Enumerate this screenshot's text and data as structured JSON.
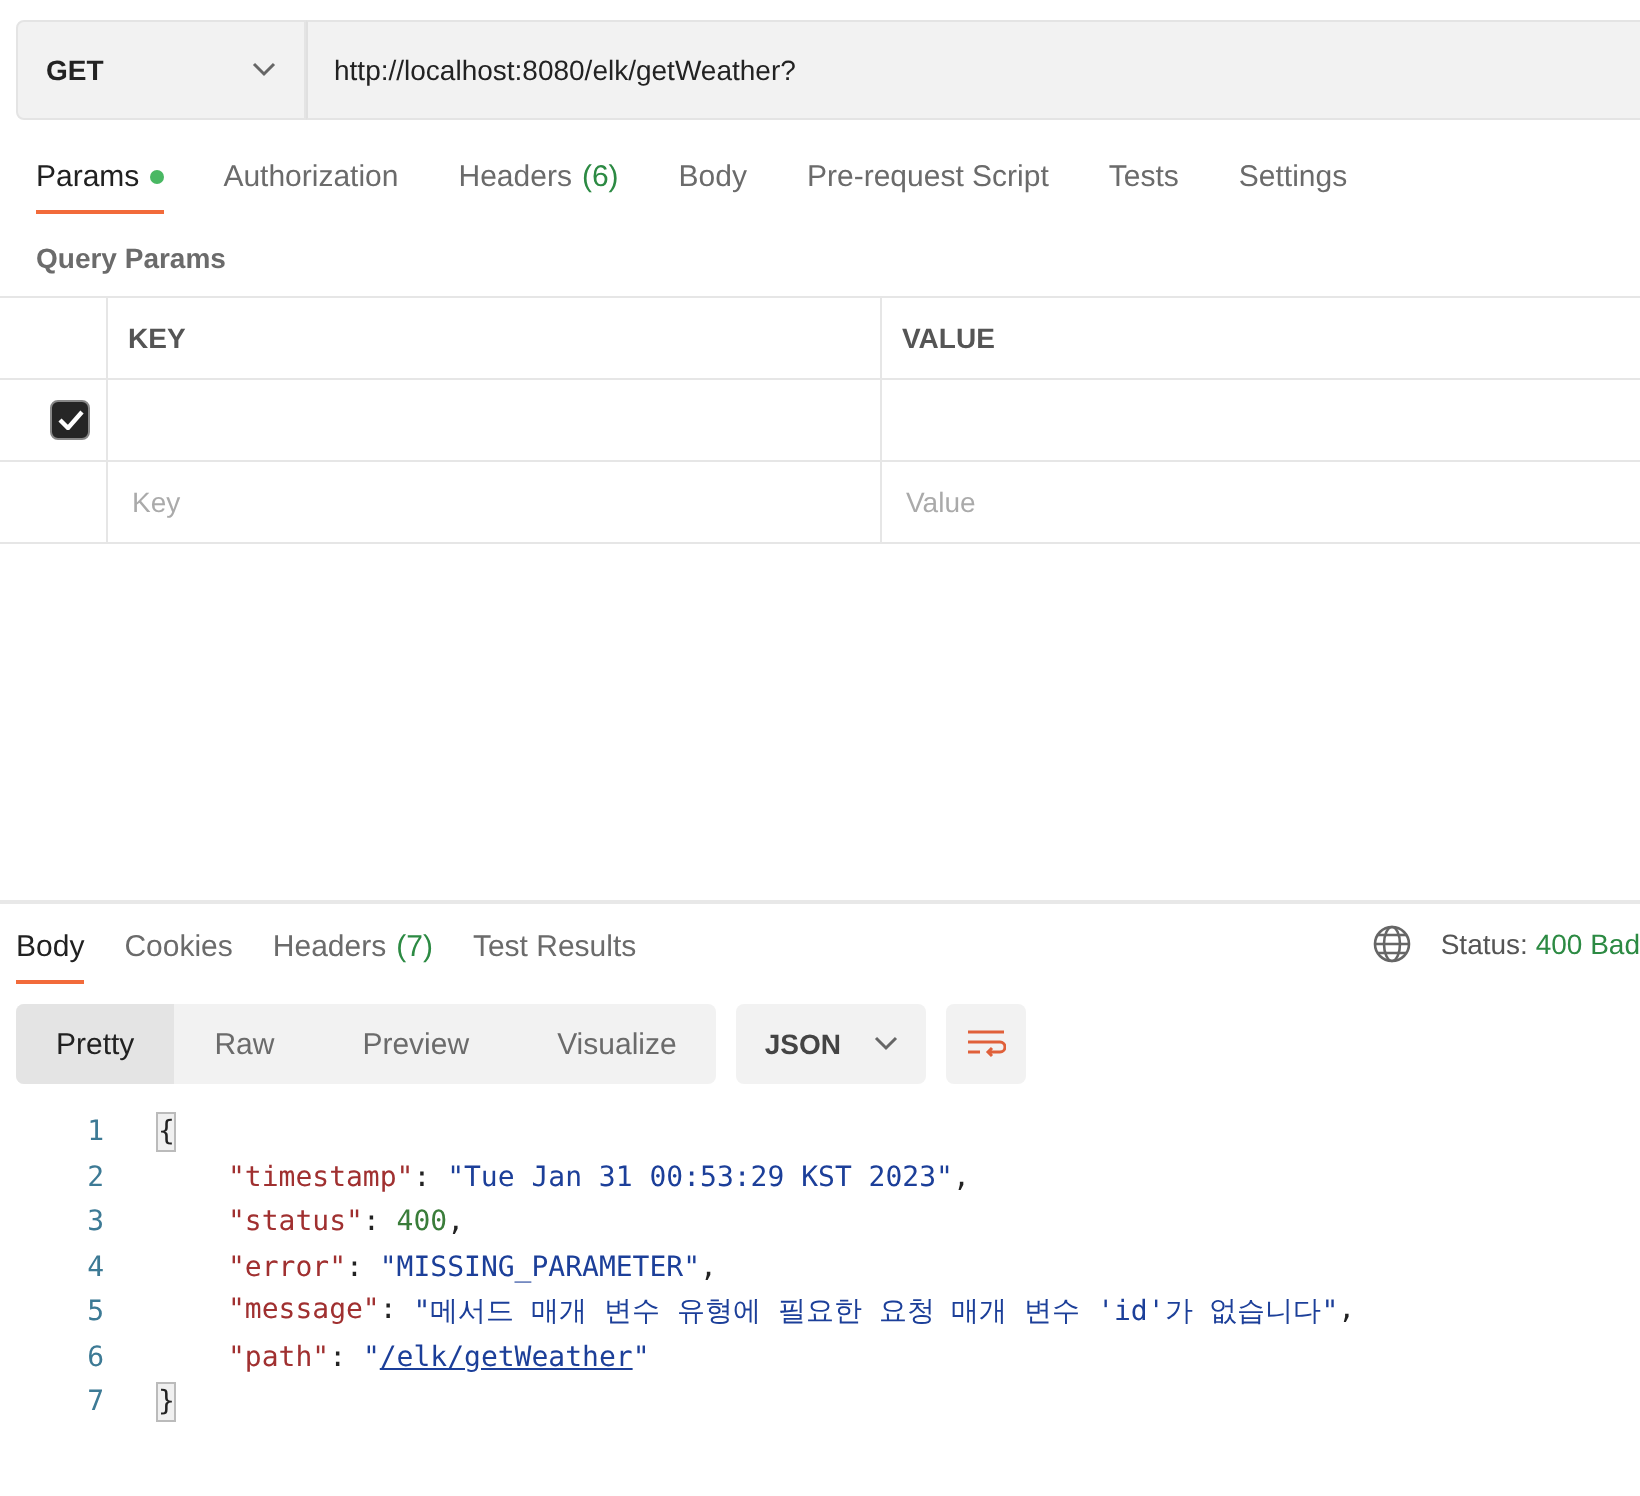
{
  "request": {
    "method": "GET",
    "url": "http://localhost:8080/elk/getWeather?"
  },
  "request_tabs": [
    {
      "label": "Params",
      "has_content": true,
      "selected": true
    },
    {
      "label": "Authorization",
      "has_content": false,
      "selected": false
    },
    {
      "label": "Headers",
      "count": "(6)",
      "has_content": false,
      "selected": false
    },
    {
      "label": "Body",
      "has_content": false,
      "selected": false
    },
    {
      "label": "Pre-request Script",
      "has_content": false,
      "selected": false
    },
    {
      "label": "Tests",
      "has_content": false,
      "selected": false
    },
    {
      "label": "Settings",
      "has_content": false,
      "selected": false
    }
  ],
  "query_params": {
    "title": "Query Params",
    "columns": [
      "KEY",
      "VALUE"
    ],
    "rows": [
      {
        "checked": true
      }
    ],
    "new_row": {
      "key_placeholder": "Key",
      "value_placeholder": "Value"
    }
  },
  "response_tabs": [
    {
      "label": "Body",
      "selected": true
    },
    {
      "label": "Cookies",
      "selected": false
    },
    {
      "label": "Headers",
      "count": "(7)",
      "selected": false
    },
    {
      "label": "Test Results",
      "selected": false
    }
  ],
  "status": {
    "label": "Status:",
    "value": "400 Bad"
  },
  "view_modes": [
    {
      "label": "Pretty",
      "selected": true
    },
    {
      "label": "Raw",
      "selected": false
    },
    {
      "label": "Preview",
      "selected": false
    },
    {
      "label": "Visualize",
      "selected": false
    }
  ],
  "format": "JSON",
  "code_lines": [
    {
      "number": "1",
      "tokens": [
        {
          "kind": "brace",
          "text": "{"
        }
      ]
    },
    {
      "number": "2",
      "tokens": [
        {
          "kind": "key",
          "text": "\"timestamp\""
        },
        {
          "kind": "punct",
          "text": ": "
        },
        {
          "kind": "string",
          "text": "\"Tue Jan 31 00:53:29 KST 2023\""
        },
        {
          "kind": "punct",
          "text": ","
        }
      ]
    },
    {
      "number": "3",
      "tokens": [
        {
          "kind": "key",
          "text": "\"status\""
        },
        {
          "kind": "punct",
          "text": ": "
        },
        {
          "kind": "number",
          "text": "400"
        },
        {
          "kind": "punct",
          "text": ","
        }
      ]
    },
    {
      "number": "4",
      "tokens": [
        {
          "kind": "key",
          "text": "\"error\""
        },
        {
          "kind": "punct",
          "text": ": "
        },
        {
          "kind": "string",
          "text": "\"MISSING_PARAMETER\""
        },
        {
          "kind": "punct",
          "text": ","
        }
      ]
    },
    {
      "number": "5",
      "tokens": [
        {
          "kind": "key",
          "text": "\"message\""
        },
        {
          "kind": "punct",
          "text": ": "
        },
        {
          "kind": "string",
          "text": "\"메서드 매개 변수 유형에 필요한 요청 매개 변수 'id'가 없습니다\""
        },
        {
          "kind": "punct",
          "text": ","
        }
      ]
    },
    {
      "number": "6",
      "tokens": [
        {
          "kind": "key",
          "text": "\"path\""
        },
        {
          "kind": "punct",
          "text": ": "
        },
        {
          "kind": "string",
          "text": "\""
        },
        {
          "kind": "link",
          "text": "/elk/getWeather"
        },
        {
          "kind": "string",
          "text": "\""
        }
      ]
    },
    {
      "number": "7",
      "tokens": [
        {
          "kind": "brace",
          "text": "}"
        }
      ]
    }
  ]
}
